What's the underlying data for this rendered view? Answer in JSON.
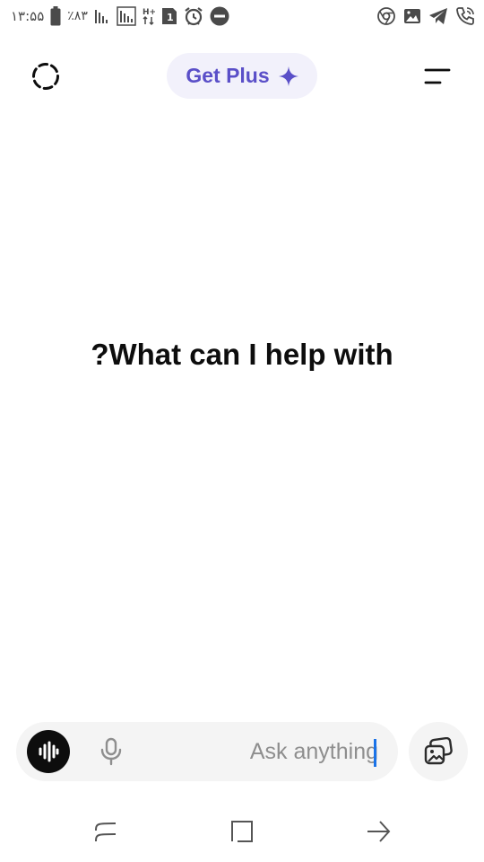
{
  "status_bar": {
    "time": "۱۳:۵۵",
    "battery_percent": "٪۸۳",
    "network_type": "H+",
    "sim_number": "1",
    "left_icons": [
      "battery-icon",
      "signal-icon",
      "signal-2-icon",
      "data-arrows-icon",
      "sim-icon",
      "alarm-icon",
      "dnd-icon"
    ],
    "right_icons": [
      "chrome-icon",
      "gallery-icon",
      "telegram-icon",
      "call-icon"
    ]
  },
  "header": {
    "history_icon": "dashed-circle-icon",
    "get_plus_label": "Get Plus",
    "get_plus_icon": "sparkle-icon",
    "menu_icon": "menu-lines-icon"
  },
  "main": {
    "prompt": "?What can I help with"
  },
  "composer": {
    "placeholder": "Ask anything",
    "value": "",
    "voice_icon": "voice-wave-icon",
    "mic_icon": "microphone-icon",
    "media_icon": "image-gallery-icon"
  },
  "nav": {
    "items": [
      "recent-apps-icon",
      "home-icon",
      "back-icon"
    ]
  },
  "colors": {
    "accent": "#5a4fc8",
    "pill_bg": "#f2f1fb",
    "composer_bg": "#f4f4f4",
    "caret": "#1a73e8"
  }
}
